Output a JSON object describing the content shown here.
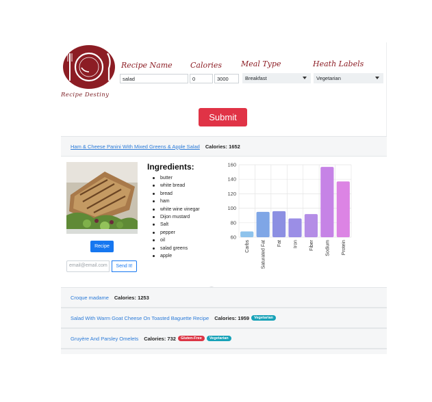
{
  "logo": {
    "text": "Recipe Destiny",
    "color": "#8c1d24"
  },
  "search": {
    "recipe_name_label": "Recipe Name",
    "recipe_name_value": "salad",
    "calories_label": "Calories",
    "calories_min": "0",
    "calories_max": "3000",
    "meal_type_label": "Meal Type",
    "meal_type_value": "Breakfast",
    "health_labels_label": "Heath Labels",
    "health_labels_value": "Vegetarian",
    "submit_label": "Submit"
  },
  "calories_prefix": "Calories:",
  "results": [
    {
      "title": "Ham & Cheese Panini With Mixed Greens & Apple Salad",
      "calories": "1652",
      "badges": []
    },
    {
      "title": "Croque madame",
      "calories": "1253",
      "badges": []
    },
    {
      "title": "Salad With Warm Goat Cheese On Toasted Baguette Recipe",
      "calories": "1959",
      "badges": [
        {
          "label": "Vegetarian",
          "color": "#17a2b8"
        }
      ]
    },
    {
      "title": "Gruyère And Parsley Omelets",
      "calories": "732",
      "badges": [
        {
          "label": "Gluten-Free",
          "color": "#dc3545"
        },
        {
          "label": "Vegetarian",
          "color": "#17a2b8"
        }
      ]
    }
  ],
  "detail": {
    "ingredients_title": "Ingredients:",
    "ingredients": [
      "butter",
      "white bread",
      "bread",
      "ham",
      "white wine vinegar",
      "Dijon mustard",
      "Salt",
      "pepper",
      "oil",
      "salad greens",
      "apple"
    ],
    "recipe_button": "Recipe",
    "email_placeholder": "email@email.com",
    "send_button": "Send It!"
  },
  "chart_data": {
    "type": "bar",
    "categories": [
      "Carbs",
      "Saturated Fat",
      "Fat",
      "Iron",
      "Fiber",
      "Sodium",
      "Protein"
    ],
    "values": [
      68,
      95,
      96,
      86,
      92,
      157,
      137
    ],
    "ylim": [
      60,
      160
    ],
    "yticks": [
      60,
      80,
      100,
      120,
      140,
      160
    ],
    "colors": [
      "#8ec3ec",
      "#7fa6e6",
      "#8c8fe2",
      "#9b8ee6",
      "#b48de6",
      "#c683e6",
      "#dc84e4"
    ],
    "grid": true
  }
}
